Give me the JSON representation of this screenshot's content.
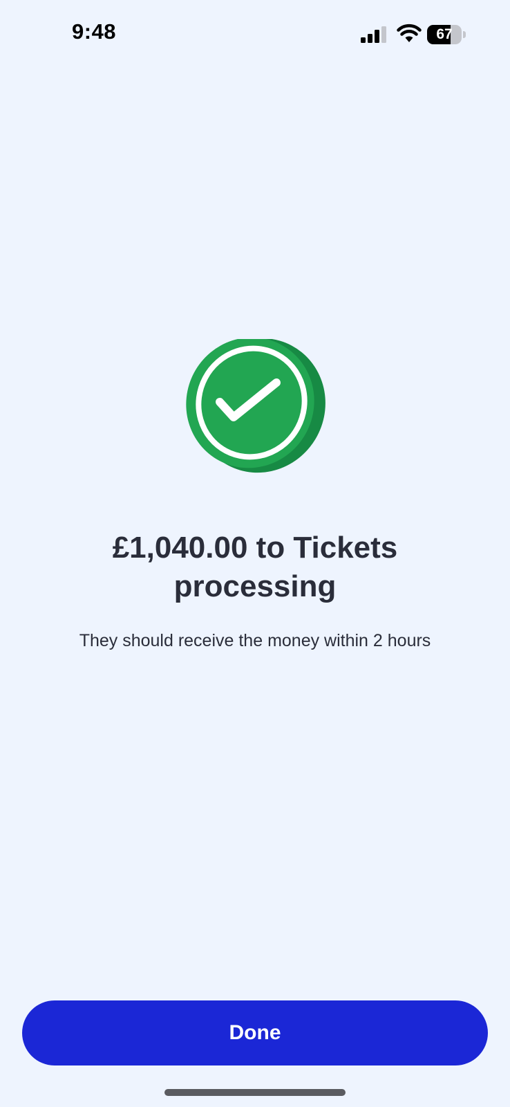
{
  "status_bar": {
    "time": "9:48",
    "battery_level": "67",
    "battery_fraction": 0.67,
    "icons": [
      "signal-icon",
      "wifi-icon",
      "battery-icon"
    ]
  },
  "confirmation": {
    "icon": "check-circle-icon",
    "headline": "£1,040.00 to Tickets processing",
    "subtitle": "They should receive the money within 2 hours"
  },
  "actions": {
    "done_label": "Done"
  },
  "colors": {
    "background": "#eef4fe",
    "accent": "#1b27d6",
    "success": "#22a652",
    "success_dark": "#178a44",
    "text": "#2a2d3a"
  }
}
